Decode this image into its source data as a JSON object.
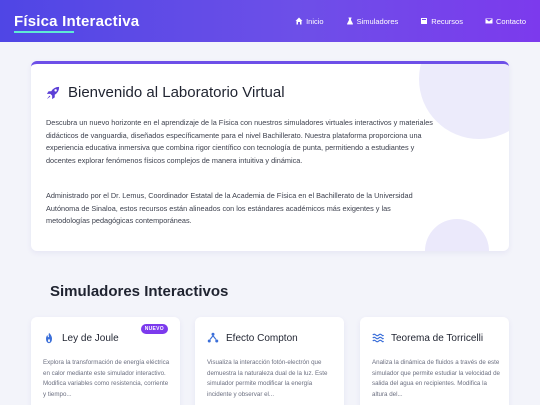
{
  "navbar": {
    "brand": "Física Interactiva",
    "links": [
      {
        "label": "Inicio",
        "icon": "home-icon"
      },
      {
        "label": "Simuladores",
        "icon": "flask-icon"
      },
      {
        "label": "Recursos",
        "icon": "book-icon"
      },
      {
        "label": "Contacto",
        "icon": "envelope-icon"
      }
    ]
  },
  "welcome": {
    "icon": "rocket-icon",
    "title": "Bienvenido al Laboratorio Virtual",
    "paragraph1": "Descubra un nuevo horizonte en el aprendizaje de la Física con nuestros simuladores virtuales interactivos y materiales didácticos de vanguardia, diseñados específicamente para el nivel Bachillerato. Nuestra plataforma proporciona una experiencia educativa inmersiva que combina rigor científico con tecnología de punta, permitiendo a estudiantes y docentes explorar fenómenos físicos complejos de manera intuitiva y dinámica.",
    "paragraph2": "Administrado por el Dr. Lemus, Coordinador Estatal de la Academia de Física en el Bachillerato de la Universidad Autónoma de Sinaloa, estos recursos están alineados con los estándares académicos más exigentes y las metodologías pedagógicas contemporáneas."
  },
  "simulators": {
    "section_title": "Simuladores Interactivos",
    "cards": [
      {
        "title": "Ley de Joule",
        "icon": "fire-icon",
        "badge": "NUEVO",
        "description": "Explora la transformación de energía eléctrica en calor mediante este simulador interactivo. Modifica variables como resistencia, corriente y tiempo..."
      },
      {
        "title": "Efecto Compton",
        "icon": "atom-icon",
        "description": "Visualiza la interacción fotón-electrón que demuestra la naturaleza dual de la luz. Este simulador permite modificar la energía incidente y observar el..."
      },
      {
        "title": "Teorema de Torricelli",
        "icon": "water-icon",
        "description": "Analiza la dinámica de fluidos a través de este simulador que permite estudiar la velocidad de salida del agua en recipientes. Modifica la altura del..."
      }
    ]
  },
  "colors": {
    "navbar_start": "#4f46e5",
    "navbar_end": "#7c3aed",
    "accent": "#6d4fe8",
    "badge": "#7c3aed",
    "underline": "#5eead4"
  }
}
